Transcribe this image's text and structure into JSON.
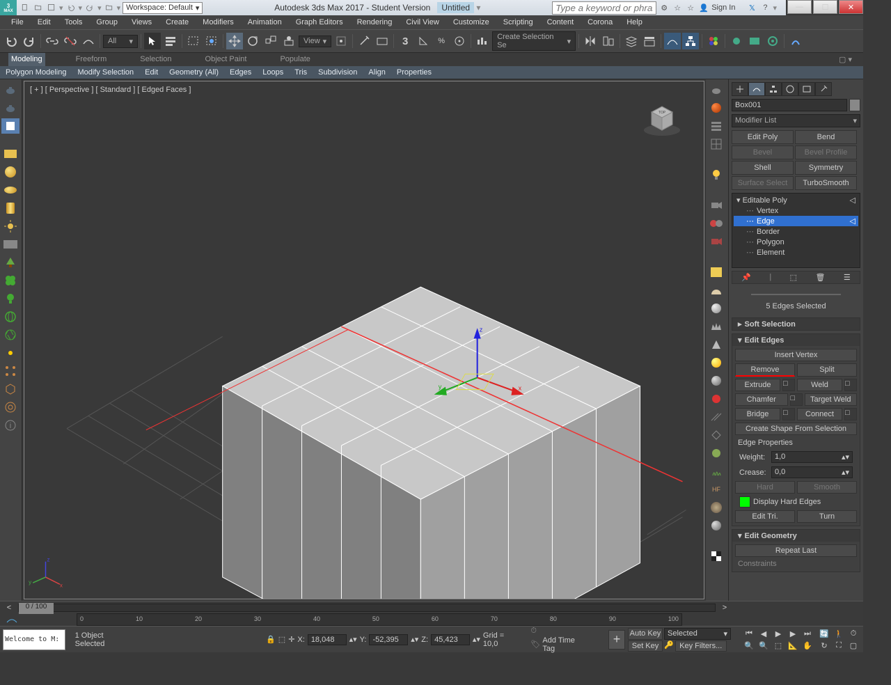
{
  "titlebar": {
    "workspace": "Workspace: Default",
    "title": "Autodesk 3ds Max 2017 - Student Version",
    "doc": "Untitled",
    "search_ph": "Type a keyword or phrase",
    "signin": "Sign In"
  },
  "menubar": [
    "File",
    "Edit",
    "Tools",
    "Group",
    "Views",
    "Create",
    "Modifiers",
    "Animation",
    "Graph Editors",
    "Rendering",
    "Civil View",
    "Customize",
    "Scripting",
    "Content",
    "Corona",
    "Help"
  ],
  "all_dd": "All",
  "view_dd": "View",
  "sel_set": "Create Selection Se",
  "ribbon": {
    "tabs": [
      "Modeling",
      "Freeform",
      "Selection",
      "Object Paint",
      "Populate"
    ],
    "sub": [
      "Polygon Modeling",
      "Modify Selection",
      "Edit",
      "Geometry (All)",
      "Edges",
      "Loops",
      "Tris",
      "Subdivision",
      "Align",
      "Properties"
    ]
  },
  "viewport": {
    "label": "[ + ] [ Perspective ] [ Standard ] [ Edged Faces ]"
  },
  "panel": {
    "object": "Box001",
    "modlist": "Modifier List",
    "modbtns": [
      {
        "l": "Edit Poly",
        "d": false
      },
      {
        "l": "Bend",
        "d": false
      },
      {
        "l": "Bevel",
        "d": true
      },
      {
        "l": "Bevel Profile",
        "d": true
      },
      {
        "l": "Shell",
        "d": false
      },
      {
        "l": "Symmetry",
        "d": false
      },
      {
        "l": "Surface Select",
        "d": true
      },
      {
        "l": "TurboSmooth",
        "d": false
      }
    ],
    "stack": {
      "head": "Editable Poly",
      "items": [
        "Vertex",
        "Edge",
        "Border",
        "Polygon",
        "Element"
      ],
      "sel": 1
    },
    "selinfo": "5 Edges Selected",
    "rollouts": {
      "soft": "Soft Selection",
      "editedges": "Edit Edges",
      "insert": "Insert Vertex",
      "remove": "Remove",
      "split": "Split",
      "extrude": "Extrude",
      "weld": "Weld",
      "chamfer": "Chamfer",
      "target": "Target Weld",
      "bridge": "Bridge",
      "connect": "Connect",
      "shape": "Create Shape From Selection",
      "edgeprops": "Edge Properties",
      "weight": "Weight:",
      "weight_v": "1,0",
      "crease": "Crease:",
      "crease_v": "0,0",
      "hard": "Hard",
      "smooth": "Smooth",
      "disphard": "Display Hard Edges",
      "edittri": "Edit Tri.",
      "turn": "Turn",
      "editgeom": "Edit Geometry",
      "repeat": "Repeat Last",
      "constraints": "Constraints"
    }
  },
  "timeline": {
    "pos": "0 / 100",
    "ticks": [
      "0",
      "10",
      "20",
      "30",
      "40",
      "50",
      "60",
      "70",
      "80",
      "90",
      "100"
    ]
  },
  "status": {
    "welcome": "Welcome to M:",
    "objsel": "1 Object Selected",
    "x": "X:",
    "xv": "18,048",
    "y": "Y:",
    "yv": "-52,395",
    "z": "Z:",
    "zv": "45,423",
    "grid": "Grid = 10,0",
    "addtag": "Add Time Tag",
    "autokey": "Auto Key",
    "selected": "Selected",
    "setkey": "Set Key",
    "keyfilt": "Key Filters..."
  }
}
